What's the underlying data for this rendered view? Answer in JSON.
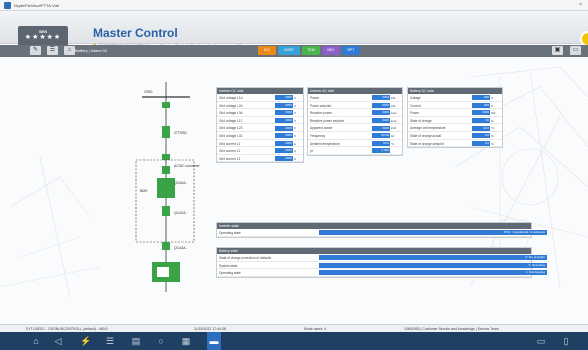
{
  "window": {
    "title": "Ncyte\\FleVisor\\PTTA.Vde",
    "close": "×"
  },
  "header": {
    "logo_top": "SEN",
    "logo_stars": "★★★★★",
    "app_title": "Master Control",
    "status_line": "11/16/2022 12:16 AM   SEN   Air conditioning (Cooler): Master collective warning 01"
  },
  "toolbar": {
    "breadcrumb": "Battery  |  Island 02",
    "tabs": [
      {
        "label": "ICV",
        "color": "#e88a1a"
      },
      {
        "label": "IWSE",
        "color": "#3aa0d8"
      },
      {
        "label": "TEM",
        "color": "#49b54b"
      },
      {
        "label": "BEV",
        "color": "#8b5fc7"
      },
      {
        "label": "BPT",
        "color": "#2f7bd6"
      }
    ]
  },
  "diagram": {
    "label_grid": "GRID",
    "label_transformer": "27TSSE-",
    "label_ac_dc": "AC/DC converter",
    "label_q1": "QCA0A-",
    "label_q2": "QCA2A-",
    "label_q3": "QCA3A-",
    "label_bms": "BMS"
  },
  "panels": {
    "inverter_dc": {
      "title": "Inverter DC side",
      "rows": [
        {
          "label": "Grid voltage L1d",
          "value": "0000",
          "unit": "V"
        },
        {
          "label": "Grid voltage L2d",
          "value": "0000",
          "unit": "V"
        },
        {
          "label": "Grid voltage L3d",
          "value": "0000",
          "unit": "V"
        },
        {
          "label": "Grid voltage L12",
          "value": "0000",
          "unit": "V"
        },
        {
          "label": "Grid voltage L23",
          "value": "0000",
          "unit": "V"
        },
        {
          "label": "Grid voltage L31",
          "value": "0000",
          "unit": "V"
        },
        {
          "label": "Grid current L1",
          "value": "0000",
          "unit": "A"
        },
        {
          "label": "Grid current L2",
          "value": "0000",
          "unit": "A"
        },
        {
          "label": "Grid current L3",
          "value": "0000",
          "unit": "A"
        }
      ]
    },
    "inverter_ac": {
      "title": "Inverter AC side",
      "rows": [
        {
          "label": "Power",
          "value": "0000",
          "unit": "kW"
        },
        {
          "label": "Power setpoint",
          "value": "0000",
          "unit": "kW"
        },
        {
          "label": "Reactive power",
          "value": "0000",
          "unit": "kvar"
        },
        {
          "label": "Reactive power setpoint",
          "value": "0000",
          "unit": "kvar"
        },
        {
          "label": "Apparent power",
          "value": "0000",
          "unit": "kVA"
        },
        {
          "label": "Frequency",
          "value": "00.00",
          "unit": "Hz"
        },
        {
          "label": "Ambient temperature",
          "value": "00.0",
          "unit": "°C"
        },
        {
          "label": "pf",
          "value": "0.000",
          "unit": ""
        }
      ]
    },
    "battery_dc": {
      "title": "Battery DC side",
      "rows": [
        {
          "label": "Voltage",
          "value": "000",
          "unit": "V"
        },
        {
          "label": "Current",
          "value": "000",
          "unit": "A"
        },
        {
          "label": "Power",
          "value": "0000",
          "unit": "kW"
        },
        {
          "label": "State of charge",
          "value": "00",
          "unit": "%"
        },
        {
          "label": "Average cell temperature",
          "value": "00.0",
          "unit": "°C"
        },
        {
          "label": "State of charge actual",
          "value": "0.0",
          "unit": "%"
        },
        {
          "label": "State of charge setpoint",
          "value": "0.0",
          "unit": "%"
        }
      ]
    },
    "inverter_state": {
      "title": "Inverter state",
      "rows": [
        {
          "label": "Operating state",
          "value": "PCS : Operational / in advance"
        }
      ]
    },
    "battery_state": {
      "title": "Battery state",
      "rows": [
        {
          "label": "State of charge protection of defaults",
          "value": "0: fire program"
        },
        {
          "label": "System state",
          "value": "3: Operating"
        },
        {
          "label": "Operating state",
          "value": "1: Discharging"
        }
      ]
    }
  },
  "statusbar": {
    "left": "SYT.LBESC - CRONUSCONTROLL (default) - WIN2",
    "mid": "11/15/2022 17:44:38",
    "alarms": "Mode users: 4",
    "right": "10652065 | Customer Service and knowledge | Service Team"
  },
  "taskbar": {
    "icons": [
      "home-icon",
      "back-icon",
      "energy-icon",
      "list-icon",
      "document-icon",
      "search-icon",
      "chart-icon",
      "settings-icon"
    ]
  }
}
